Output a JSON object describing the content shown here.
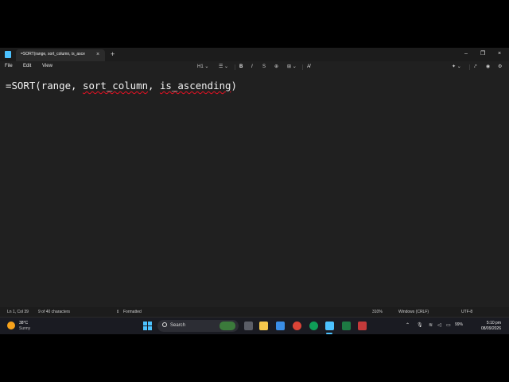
{
  "window": {
    "tab_title": "=SORT(range, sort_column, is_asce",
    "tab_close": "×",
    "new_tab": "+",
    "minimize": "–",
    "maximize": "❐",
    "close": "×"
  },
  "menu": {
    "file": "File",
    "edit": "Edit",
    "view": "View"
  },
  "toolbar": {
    "heading": "H1 ⌄",
    "list": "☰ ⌄",
    "bold": "B",
    "italic": "I",
    "strikethrough": "S",
    "link": "⊕",
    "table": "⊞ ⌄",
    "clear_format": "A̸",
    "copilot": "✦ ⌄",
    "share": "⤤",
    "gear": "⚙"
  },
  "editor": {
    "text_before": "=SORT(range, ",
    "word_sort_column": "sort_column",
    "text_middle": ", ",
    "word_is_ascending": "is_ascending",
    "text_after": ")"
  },
  "status": {
    "position": "Ln 1, Col 39",
    "chars": "9 of 40 characters",
    "format": "Formatted",
    "zoom": "310%",
    "line_ending": "Windows (CRLF)",
    "encoding": "UTF-8"
  },
  "taskbar": {
    "weather_temp": "38°C",
    "weather_condition": "Sunny",
    "search_label": "Search",
    "tray_chevron": "⌃",
    "battery": "99%",
    "time": "5:10 pm",
    "date": "08/09/2026",
    "icons": [
      "start-icon",
      "file-explorer-icon",
      "folder-icon",
      "store-icon",
      "chrome-icon",
      "chrome-icon",
      "notepad-icon",
      "excel-icon",
      "app-icon"
    ]
  },
  "colors": {
    "accent": "#4cc2ff",
    "background": "#202020",
    "spellcheck": "#e81123"
  }
}
